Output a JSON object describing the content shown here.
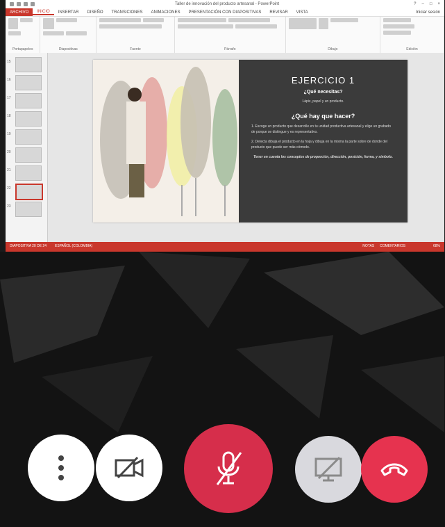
{
  "app": {
    "title": "Taller de innovación del producto artesanal - PowerPoint",
    "tabs": [
      "ARCHIVO",
      "INICIO",
      "INSERTAR",
      "DISEÑO",
      "TRANSICIONES",
      "ANIMACIONES",
      "PRESENTACIÓN CON DIAPOSITIVAS",
      "REVISAR",
      "VISTA"
    ],
    "active_tab": "INICIO",
    "ribbon_groups": [
      "Portapapeles",
      "Diapositivas",
      "Fuente",
      "Párrafo",
      "Dibujo",
      "Edición"
    ],
    "user": "Iniciar sesión"
  },
  "thumbnails": [
    {
      "num": "15"
    },
    {
      "num": "16"
    },
    {
      "num": "17"
    },
    {
      "num": "18"
    },
    {
      "num": "19"
    },
    {
      "num": "20"
    },
    {
      "num": "21"
    },
    {
      "num": "22"
    },
    {
      "num": "23"
    }
  ],
  "slide": {
    "title": "EJERCICIO 1",
    "q1": "¿Qué necesitas?",
    "a1": "Lápiz, papel y un producto.",
    "q2": "¿Qué hay que hacer?",
    "step1": "1.  Escoge un producto que desarrolle en tu unidad productiva artesanal y elige un grabado de porque se distingue y es representativo.",
    "step2": "2. Detecta dibuja el producto en la hoja y dibuja en la misma la parte sobre de donde del producto que puede ser más cómodo.",
    "note": "Tener en cuenta los conceptos de proporción, dirección, posición, forma, y símbolo."
  },
  "statusbar": {
    "left": "DIAPOSITIVA 20 DE 24",
    "lang": "ESPAÑOL (COLOMBIA)",
    "notes": "NOTAS",
    "comments": "COMENTARIOS",
    "zoom": "68%"
  },
  "controls": {
    "more": "more-options",
    "camera": "camera-off",
    "mic": "microphone-muted",
    "share": "screen-share-off",
    "hangup": "hang-up"
  }
}
